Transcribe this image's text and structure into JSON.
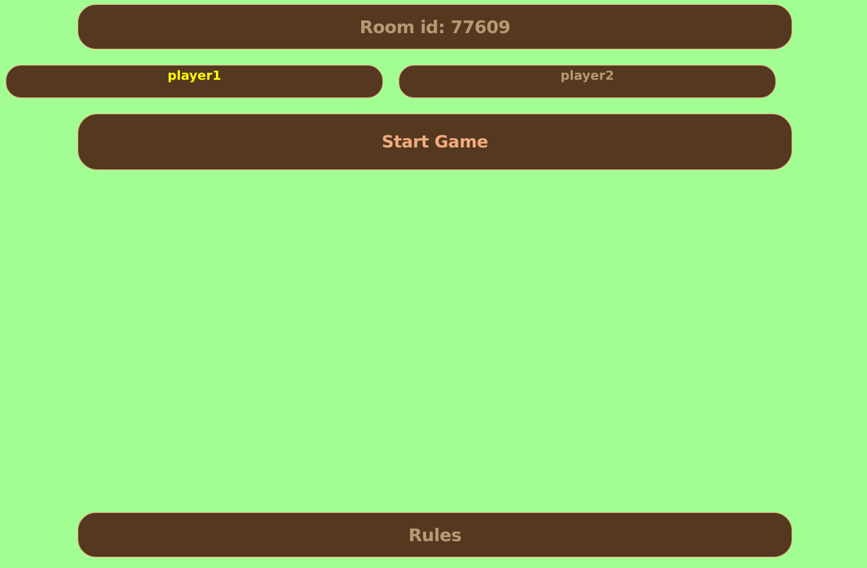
{
  "room": {
    "label": "Room id: 77609"
  },
  "players": [
    {
      "name": "player1",
      "color": "#ffff00"
    },
    {
      "name": "player2",
      "color": "#b69a73"
    }
  ],
  "actions": {
    "start_label": "Start Game",
    "rules_label": "Rules"
  },
  "theme": {
    "background": "#a2fe92",
    "panel": "#543820",
    "panel_border": "#e8a17a"
  }
}
